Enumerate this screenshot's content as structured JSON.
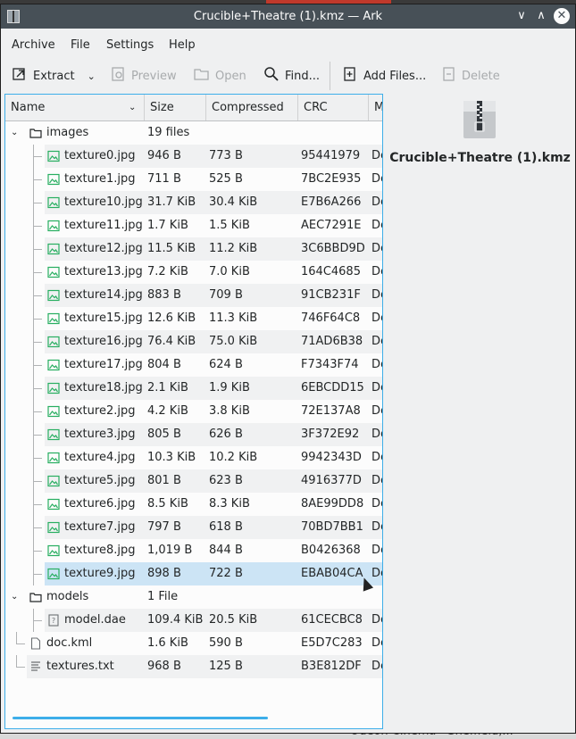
{
  "window": {
    "title": "Crucible+Theatre (1).kmz — Ark",
    "app_icon": "ark-icon"
  },
  "background": {
    "bottom_text": "Odeon Cinema - Sheffield,..."
  },
  "menubar": [
    "Archive",
    "File",
    "Settings",
    "Help"
  ],
  "toolbar": {
    "extract": "Extract",
    "preview": "Preview",
    "open": "Open",
    "find": "Find...",
    "add_files": "Add Files...",
    "delete": "Delete"
  },
  "columns": [
    "Name",
    "Size",
    "Compressed",
    "CRC",
    "M"
  ],
  "rows": [
    {
      "name": "images",
      "size": "19 files",
      "compressed": "",
      "crc": "",
      "method": "",
      "type": "folder",
      "level": 0
    },
    {
      "name": "texture0.jpg",
      "size": "946 B",
      "compressed": "773 B",
      "crc": "95441979",
      "method": "De",
      "type": "image",
      "level": 1
    },
    {
      "name": "texture1.jpg",
      "size": "711 B",
      "compressed": "525 B",
      "crc": "7BC2E935",
      "method": "De",
      "type": "image",
      "level": 1
    },
    {
      "name": "texture10.jpg",
      "size": "31.7 KiB",
      "compressed": "30.4 KiB",
      "crc": "E7B6A266",
      "method": "De",
      "type": "image",
      "level": 1
    },
    {
      "name": "texture11.jpg",
      "size": "1.7 KiB",
      "compressed": "1.5 KiB",
      "crc": "AEC7291E",
      "method": "De",
      "type": "image",
      "level": 1
    },
    {
      "name": "texture12.jpg",
      "size": "11.5 KiB",
      "compressed": "11.2 KiB",
      "crc": "3C6BBD9D",
      "method": "De",
      "type": "image",
      "level": 1
    },
    {
      "name": "texture13.jpg",
      "size": "7.2 KiB",
      "compressed": "7.0 KiB",
      "crc": "164C4685",
      "method": "De",
      "type": "image",
      "level": 1
    },
    {
      "name": "texture14.jpg",
      "size": "883 B",
      "compressed": "709 B",
      "crc": "91CB231F",
      "method": "De",
      "type": "image",
      "level": 1
    },
    {
      "name": "texture15.jpg",
      "size": "12.6 KiB",
      "compressed": "11.3 KiB",
      "crc": "746F64C8",
      "method": "De",
      "type": "image",
      "level": 1
    },
    {
      "name": "texture16.jpg",
      "size": "76.4 KiB",
      "compressed": "75.0 KiB",
      "crc": "71AD6B38",
      "method": "De",
      "type": "image",
      "level": 1
    },
    {
      "name": "texture17.jpg",
      "size": "804 B",
      "compressed": "624 B",
      "crc": "F7343F74",
      "method": "De",
      "type": "image",
      "level": 1
    },
    {
      "name": "texture18.jpg",
      "size": "2.1 KiB",
      "compressed": "1.9 KiB",
      "crc": "6EBCDD15",
      "method": "De",
      "type": "image",
      "level": 1
    },
    {
      "name": "texture2.jpg",
      "size": "4.2 KiB",
      "compressed": "3.8 KiB",
      "crc": "72E137A8",
      "method": "De",
      "type": "image",
      "level": 1
    },
    {
      "name": "texture3.jpg",
      "size": "805 B",
      "compressed": "626 B",
      "crc": "3F372E92",
      "method": "De",
      "type": "image",
      "level": 1
    },
    {
      "name": "texture4.jpg",
      "size": "10.3 KiB",
      "compressed": "10.2 KiB",
      "crc": "9942343D",
      "method": "De",
      "type": "image",
      "level": 1
    },
    {
      "name": "texture5.jpg",
      "size": "801 B",
      "compressed": "623 B",
      "crc": "4916377D",
      "method": "De",
      "type": "image",
      "level": 1
    },
    {
      "name": "texture6.jpg",
      "size": "8.5 KiB",
      "compressed": "8.3 KiB",
      "crc": "8AE99DD8",
      "method": "De",
      "type": "image",
      "level": 1
    },
    {
      "name": "texture7.jpg",
      "size": "797 B",
      "compressed": "618 B",
      "crc": "70BD7BB1",
      "method": "De",
      "type": "image",
      "level": 1
    },
    {
      "name": "texture8.jpg",
      "size": "1,019 B",
      "compressed": "844 B",
      "crc": "B0426368",
      "method": "De",
      "type": "image",
      "level": 1
    },
    {
      "name": "texture9.jpg",
      "size": "898 B",
      "compressed": "722 B",
      "crc": "EBAB04CA",
      "method": "De",
      "type": "image",
      "level": 1,
      "selected": true
    },
    {
      "name": "models",
      "size": "1 File",
      "compressed": "",
      "crc": "",
      "method": "",
      "type": "folder",
      "level": 0
    },
    {
      "name": "model.dae",
      "size": "109.4 KiB",
      "compressed": "20.5 KiB",
      "crc": "61CECBC8",
      "method": "De",
      "type": "unknown",
      "level": 1
    },
    {
      "name": "doc.kml",
      "size": "1.6 KiB",
      "compressed": "590 B",
      "crc": "E5D7C283",
      "method": "De",
      "type": "file",
      "level": 0
    },
    {
      "name": "textures.txt",
      "size": "968 B",
      "compressed": "125 B",
      "crc": "B3E812DF",
      "method": "De",
      "type": "text",
      "level": 0
    }
  ],
  "sidebar": {
    "filename": "Crucible+Theatre (1).kmz",
    "icon": "zip-archive-icon"
  },
  "colors": {
    "titlebar": "#475057",
    "accent": "#3daee9",
    "selection": "#cce4f5",
    "image_icon": "#27ae60"
  }
}
